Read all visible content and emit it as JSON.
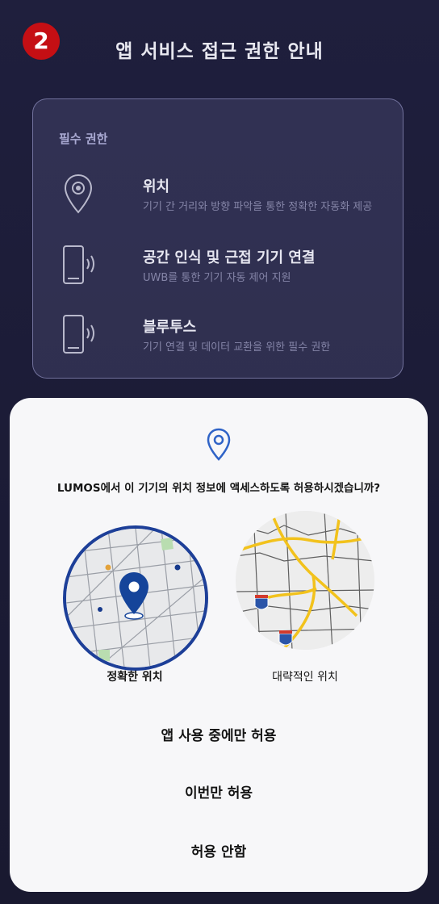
{
  "step_badge": "2",
  "title": "앱 서비스 접근 권한 안내",
  "permissions": {
    "section_title": "필수 권한",
    "items": [
      {
        "icon": "location-pin-icon",
        "name": "위치",
        "description": "기기 간 거리와 방향 파악을 통한 정확한 자동화 제공"
      },
      {
        "icon": "phone-signal-icon",
        "name": "공간 인식 및 근접 기기 연결",
        "description": "UWB를 통한 기기 자동 제어 지원"
      },
      {
        "icon": "phone-signal-icon",
        "name": "블루투스",
        "description": "기기 연결 및 데이터 교환을 위한 필수 권한"
      }
    ]
  },
  "dialog": {
    "icon": "location-pin-icon",
    "question": "LUMOS에서 이 기기의 위치 정보에 액세스하도록 허용하시겠습니까?",
    "precise_label": "정확한 위치",
    "approximate_label": "대략적인 위치",
    "options": [
      "앱 사용 중에만 허용",
      "이번만 허용",
      "허용 안함"
    ],
    "colors": {
      "accent": "#1d3f98",
      "pin": "#15449a",
      "road": "#f2c21c"
    }
  }
}
